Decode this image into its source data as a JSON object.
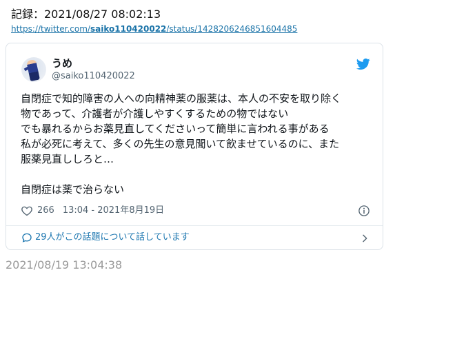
{
  "record": {
    "text": "記録：2021/08/27 08:02:13"
  },
  "source": {
    "prefix": "https://twitter.com/",
    "user": "saiko110420022",
    "suffix": "/status/1428206246851604485"
  },
  "tweet": {
    "display_name": "うめ",
    "handle": "@saiko110420022",
    "lines": [
      "自閉症で知的障害の人への向精神薬の服薬は、本人の不安を取り除く",
      "物であって、介護者が介護しやすくするための物ではない",
      "でも暴れるからお薬見直してくださいって簡単に言われる事がある",
      "私が必死に考えて、多くの先生の意見聞いて飲ませているのに、また",
      "服薬見直ししろと…",
      "",
      "自閉症は薬で治らない"
    ],
    "likes": "266",
    "time": "13:04 - 2021年8月19日",
    "conversation": "29人がこの話題について話しています"
  },
  "saved_timestamp": "2021/08/19 13:04:38",
  "colors": {
    "link": "#1a73a8",
    "twitter_blue": "#1d9bf0",
    "muted": "#536471"
  }
}
